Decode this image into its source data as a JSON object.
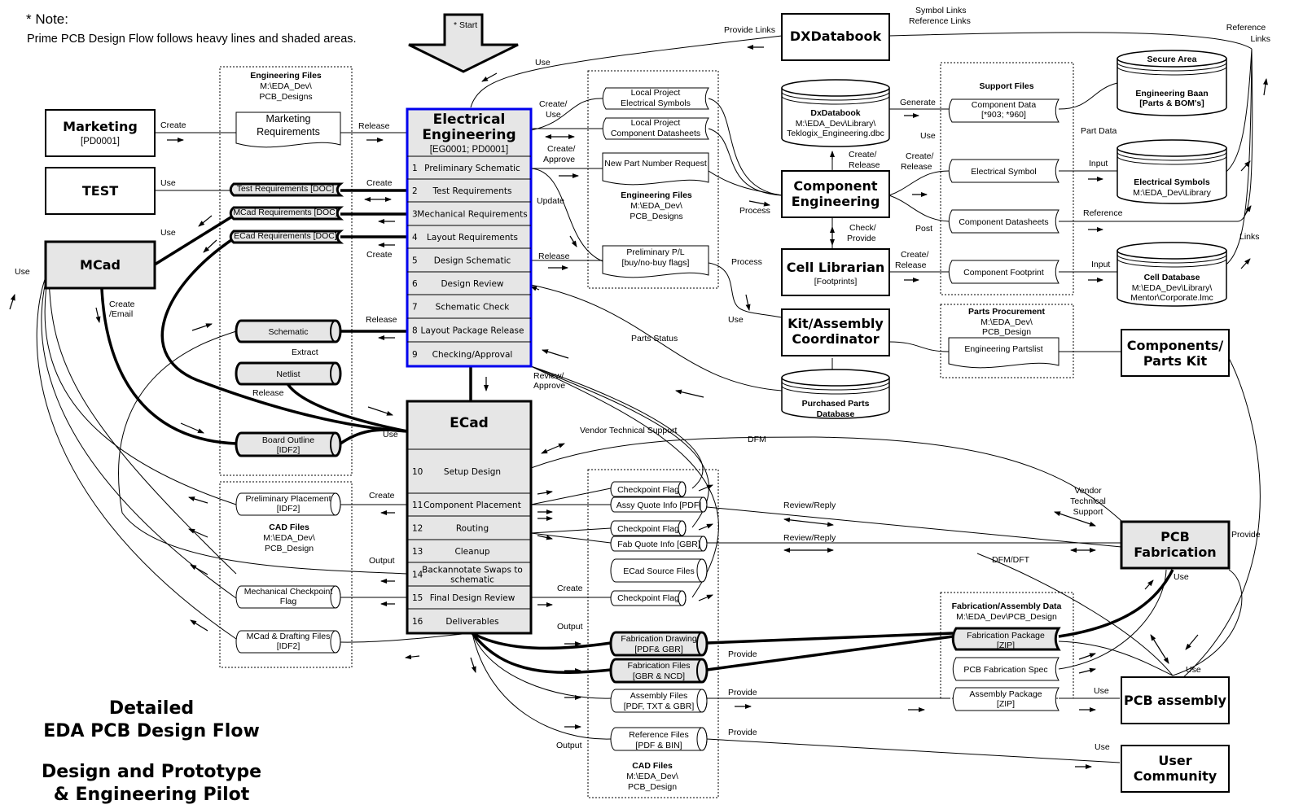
{
  "note": {
    "heading": "* Note:",
    "text": "Prime PCB Design Flow follows heavy lines and shaded areas."
  },
  "start_label": "* Start",
  "title": {
    "line1": "Detailed",
    "line2": "EDA PCB Design Flow",
    "line3": "Design and Prototype",
    "line4": "& Engineering Pilot"
  },
  "colors": {
    "highlight_border": "#0000ee",
    "shaded_fill": "#e6e6e6"
  },
  "nodes": {
    "marketing": {
      "title": "Marketing",
      "sub": "[PD0001]"
    },
    "test": {
      "title": "TEST"
    },
    "mcad": {
      "title": "MCad"
    },
    "electrical_engineering": {
      "title1": "Electrical",
      "title2": "Engineering",
      "sub": "[EG0001; PD0001]",
      "steps": [
        {
          "num": "1",
          "label": "Preliminary Schematic"
        },
        {
          "num": "2",
          "label": "Test Requirements"
        },
        {
          "num": "3",
          "label": "Mechanical Requirements"
        },
        {
          "num": "4",
          "label": "Layout Requirements"
        },
        {
          "num": "5",
          "label": "Design Schematic"
        },
        {
          "num": "6",
          "label": "Design Review"
        },
        {
          "num": "7",
          "label": "Schematic Check"
        },
        {
          "num": "8",
          "label": "Layout Package Release"
        },
        {
          "num": "9",
          "label": "Checking/Approval"
        }
      ]
    },
    "ecad": {
      "title": "ECad",
      "steps": [
        {
          "num": "10",
          "label": "Setup Design"
        },
        {
          "num": "11",
          "label": "Component Placement"
        },
        {
          "num": "12",
          "label": "Routing"
        },
        {
          "num": "13",
          "label": "Cleanup"
        },
        {
          "num": "14",
          "label": "Backannotate Swaps to",
          "label2": "schematic"
        },
        {
          "num": "15",
          "label": "Final Design Review"
        },
        {
          "num": "16",
          "label": "Deliverables"
        }
      ]
    },
    "dxdatabook": {
      "title": "DXDatabook"
    },
    "component_engineering": {
      "title1": "Component",
      "title2": "Engineering"
    },
    "cell_librarian": {
      "title": "Cell Librarian",
      "sub": "[Footprints]"
    },
    "kit_assembly": {
      "title1": "Kit/Assembly",
      "title2": "Coordinator"
    },
    "components_parts_kit": {
      "title1": "Components/",
      "title2": "Parts Kit"
    },
    "pcb_fabrication": {
      "title1": "PCB",
      "title2": "Fabrication"
    },
    "pcb_assembly": {
      "title": "PCB assembly"
    },
    "user_community": {
      "title1": "User",
      "title2": "Community"
    }
  },
  "databases": {
    "dxdatabook_db": {
      "title": "DxDatabook",
      "line2": "M:\\EDA_Dev\\Library\\",
      "line3": "Teklogix_Engineering.dbc"
    },
    "secure_area": {
      "title": "Secure Area",
      "line2": "Engineering Baan",
      "line3": "[Parts & BOM's]"
    },
    "electrical_symbols": {
      "title": "Electrical Symbols",
      "line2": "M:\\EDA_Dev\\Library"
    },
    "cell_database": {
      "title": "Cell Database",
      "line2": "M:\\EDA_Dev\\Library\\",
      "line3": "Mentor\\Corporate.lmc"
    },
    "purchased_parts": {
      "line1": "Purchased Parts",
      "line2": "Database"
    }
  },
  "groups": {
    "engineering_files_left": {
      "title": "Engineering Files",
      "line2": "M:\\EDA_Dev\\",
      "line3": "PCB_Designs"
    },
    "engineering_files_mid": {
      "title": "Engineering Files",
      "line2": "M:\\EDA_Dev\\",
      "line3": "PCB_Designs"
    },
    "support_files": {
      "title": "Support Files"
    },
    "parts_procurement": {
      "title": "Parts Procurement",
      "line2": "M:\\EDA_Dev\\",
      "line3": "PCB_Design"
    },
    "cad_files_left": {
      "title": "CAD Files",
      "line2": "M:\\EDA_Dev\\",
      "line3": "PCB_Design"
    },
    "cad_files_bottom": {
      "title": "CAD Files",
      "line2": "M:\\EDA_Dev\\",
      "line3": "PCB_Design"
    },
    "fab_assembly_data": {
      "title": "Fabrication/Assembly Data",
      "line2": "M:\\EDA_Dev\\PCB_Design"
    }
  },
  "documents": {
    "marketing_requirements": {
      "line1": "Marketing",
      "line2": "Requirements"
    },
    "test_requirements": {
      "line1": "Test Requirements [DOC]"
    },
    "mcad_requirements": {
      "line1": "MCad Requirements [DOC]"
    },
    "ecad_requirements": {
      "line1": "ECad Requirements [DOC]"
    },
    "schematic": {
      "line1": "Schematic"
    },
    "netlist": {
      "line1": "Netlist"
    },
    "board_outline": {
      "line1": "Board  Outline",
      "line2": "[IDF2]"
    },
    "local_symbols": {
      "line1": "Local Project",
      "line2": "Electrical Symbols"
    },
    "local_datasheets": {
      "line1": "Local Project",
      "line2": "Component Datasheets"
    },
    "new_part_request": {
      "line1": "New Part Number Request"
    },
    "preliminary_pl": {
      "line1": "Preliminary P/L",
      "line2": "[buy/no-buy flags]"
    },
    "component_data": {
      "line1": "Component Data",
      "line2": "[*903; *960]"
    },
    "electrical_symbol": {
      "line1": "Electrical Symbol"
    },
    "component_datasheets": {
      "line1": "Component Datasheets"
    },
    "component_footprint": {
      "line1": "Component Footprint"
    },
    "engineering_partslist": {
      "line1": "Engineering Partslist"
    },
    "preliminary_placement": {
      "line1": "Preliminary Placement",
      "line2": "[IDF2]"
    },
    "mech_checkpoint": {
      "line1": "Mechanical Checkpoint",
      "line2": "Flag"
    },
    "mcad_drafting": {
      "line1": "MCad & Drafting Files",
      "line2": "[IDF2]"
    },
    "checkpoint_flag_1": {
      "line1": "Checkpoint Flag"
    },
    "assy_quote": {
      "line1": "Assy Quote Info [PDF]"
    },
    "checkpoint_flag_2": {
      "line1": "Checkpoint Flag"
    },
    "fab_quote": {
      "line1": "Fab Quote Info [GBR]"
    },
    "ecad_source": {
      "line1": "ECad Source Files"
    },
    "checkpoint_flag_3": {
      "line1": "Checkpoint Flag"
    },
    "fab_drawing": {
      "line1": "Fabrication Drawing",
      "line2": "[PDF& GBR]"
    },
    "fab_files": {
      "line1": "Fabrication Files",
      "line2": "[GBR & NCD]"
    },
    "assembly_files": {
      "line1": "Assembly Files",
      "line2": "[PDF, TXT & GBR]"
    },
    "reference_files": {
      "line1": "Reference Files",
      "line2": "[PDF & BIN]"
    },
    "fab_package": {
      "line1": "Fabrication Package",
      "line2": "[ZIP]"
    },
    "pcb_fab_spec": {
      "line1": "PCB Fabrication Spec"
    },
    "assembly_package": {
      "line1": "Assembly Package",
      "line2": "[ZIP]"
    }
  },
  "edge_labels": {
    "marketing_create": "Create",
    "marketing_release": "Release",
    "test_use": "Use",
    "test_create": "Create",
    "mcad_use_top": "Use",
    "ecadreq_create": "Create",
    "mcad_use_left": "Use",
    "mcad_create_email_1": "Create",
    "mcad_create_email_2": "/Email",
    "schematic_release": "Release",
    "extract": "Extract",
    "netlist_release": "Release",
    "ecad_use": "Use",
    "dx_use": "Use",
    "provide_links": "Provide Links",
    "symbol_links": "Symbol Links",
    "reference_links_top": "Reference Links",
    "reference_links_right1": "Reference",
    "reference_links_right2": "Links",
    "create_use_1": "Create/",
    "create_use_2": "Use",
    "create_approve_1": "Create/",
    "create_approve_2": "Approve",
    "update": "Update",
    "release_pl": "Release",
    "process_1": "Process",
    "process_2": "Process",
    "generate": "Generate",
    "ce_use": "Use",
    "create_release_db_1": "Create/",
    "create_release_db_2": "Release",
    "create_release_sym_1": "Create/",
    "create_release_sym_2": "Release",
    "post": "Post",
    "check_provide_1": "Check/",
    "check_provide_2": "Provide",
    "create_release_fp_1": "Create/",
    "create_release_fp_2": "Release",
    "part_data": "Part Data",
    "input_1": "Input",
    "reference": "Reference",
    "input_2": "Input",
    "links": "Links",
    "kit_use": "Use",
    "parts_status": "Parts Status",
    "review_approve_1": "Review/",
    "review_approve_2": "Approve",
    "vendor_tech_support": "Vendor Technical Support",
    "dfm": "DFM",
    "review_reply_1": "Review/Reply",
    "review_reply_2": "Review/Reply",
    "dfm_dft": "DFM/DFT",
    "vendor_ts_1": "Vendor",
    "vendor_ts_2": "Technical",
    "vendor_ts_3": "Support",
    "pcbfab_provide": "Provide",
    "pcbfab_use": "Use",
    "pcbassy_use_top": "Use",
    "pcbassy_use_left": "Use",
    "user_use": "Use",
    "placement_create": "Create",
    "ecad_output": "Output",
    "checkpoint_create": "Create",
    "deliv_output_top": "Output",
    "deliv_output_bottom": "Output",
    "provide_fab": "Provide",
    "provide_assy": "Provide",
    "provide_ref": "Provide"
  }
}
